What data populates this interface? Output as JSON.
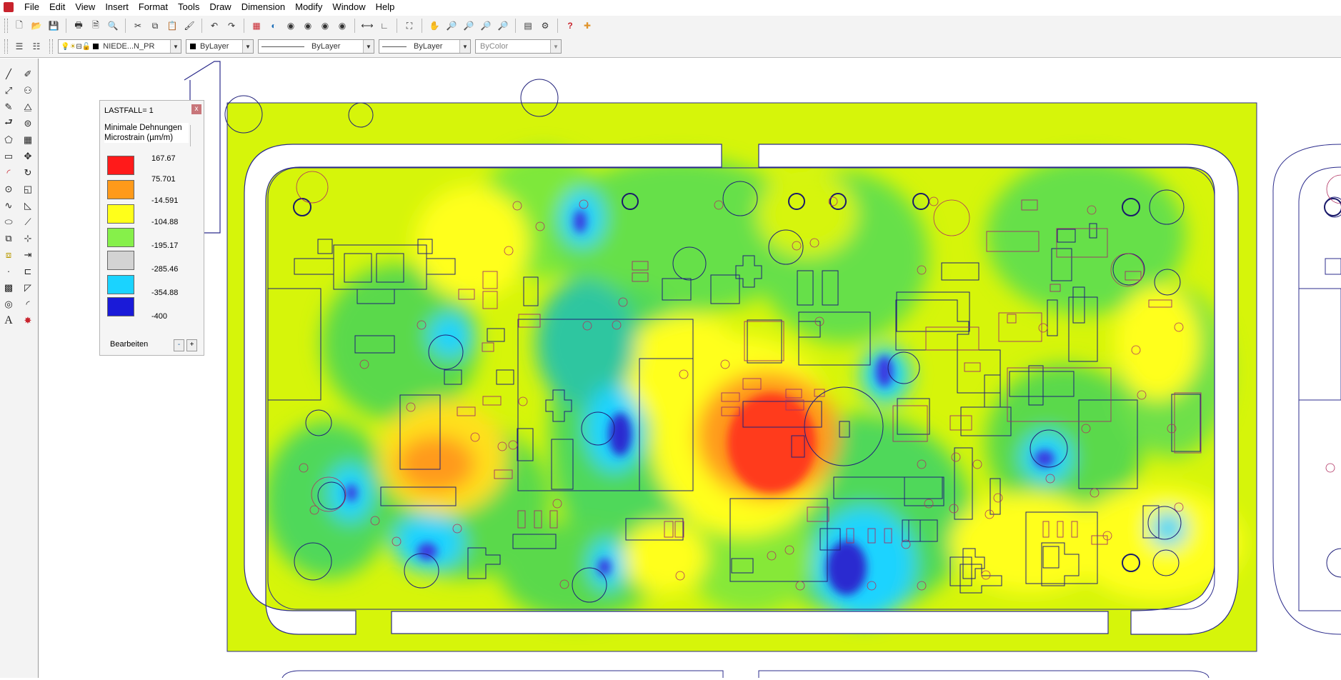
{
  "menubar": {
    "items": [
      "File",
      "Edit",
      "View",
      "Insert",
      "Format",
      "Tools",
      "Draw",
      "Dimension",
      "Modify",
      "Window",
      "Help"
    ]
  },
  "layer_bar": {
    "layer_name": "NIEDE...N_PR",
    "color": "ByLayer",
    "linetype": "ByLayer",
    "lineweight": "ByLayer",
    "plotstyle": "ByColor"
  },
  "legend": {
    "loadcase": "LASTFALL=  1",
    "close_label": "x",
    "title": "Minimale Dehnungen",
    "unit": "Microstrain (µm/m)",
    "entries": [
      {
        "value": "167.67",
        "color": "#ff1a1a"
      },
      {
        "value": "75.701",
        "color": "#ff9a1a"
      },
      {
        "value": "-14.591",
        "color": "#ffff1a"
      },
      {
        "value": "-104.88",
        "color": "#86f04a"
      },
      {
        "value": "-195.17",
        "color": "#d3d3d3"
      },
      {
        "value": "-285.46",
        "color": "#1ad3ff"
      },
      {
        "value": "-354.88",
        "color": "#1a1ad8"
      },
      {
        "value": "-400",
        "color": ""
      }
    ],
    "edit_label": "Bearbeiten",
    "minus_label": "-",
    "plus_label": "+"
  }
}
